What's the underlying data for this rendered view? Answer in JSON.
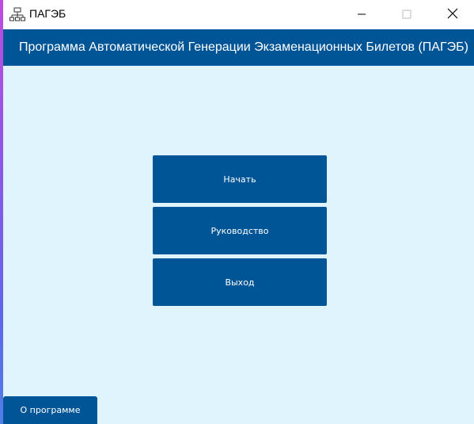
{
  "window": {
    "title": "ПАГЭБ",
    "app_icon": "network-computers-icon",
    "controls": {
      "minimize_icon": "minimize-icon",
      "maximize_icon": "maximize-icon",
      "close_icon": "close-icon"
    }
  },
  "header": {
    "title": "Программа Автоматической Генерации Экзаменационных Билетов (ПАГЭБ)"
  },
  "main_menu": {
    "start_label": "Начать",
    "guide_label": "Руководство",
    "exit_label": "Выход"
  },
  "footer": {
    "about_label": "О программе"
  },
  "colors": {
    "accent": "#005596",
    "background": "#dff4fd",
    "titlebar": "#ffffff"
  }
}
